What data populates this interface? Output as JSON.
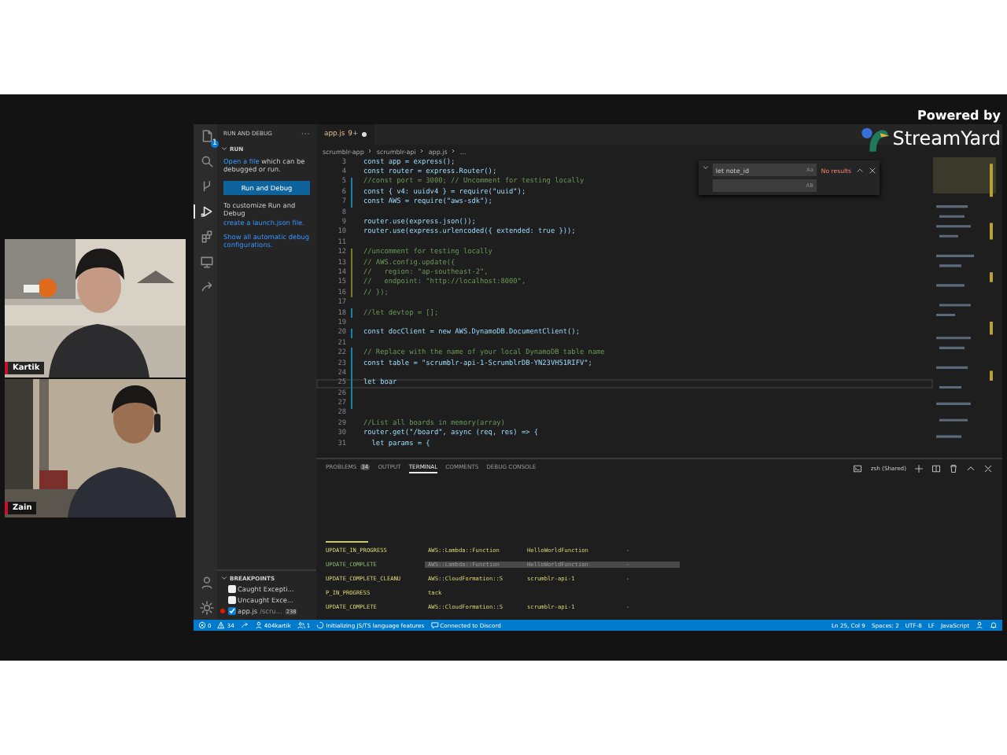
{
  "branding": {
    "powered_by": "Powered by",
    "logo_text": "StreamYard"
  },
  "participants": [
    {
      "name": "Kartik"
    },
    {
      "name": "Zain"
    }
  ],
  "editor_window": {
    "activity_bar": [
      {
        "kind": "files",
        "selected": false,
        "badge": "1"
      },
      {
        "kind": "search",
        "selected": false
      },
      {
        "kind": "branch",
        "selected": false
      },
      {
        "kind": "debug",
        "selected": true
      },
      {
        "kind": "extensions",
        "selected": false
      },
      {
        "kind": "remote",
        "selected": false
      },
      {
        "kind": "share",
        "selected": false
      }
    ],
    "activity_bar_bottom": [
      {
        "kind": "account"
      },
      {
        "kind": "gear"
      }
    ],
    "sidebar": {
      "title": "RUN AND DEBUG",
      "section": "RUN",
      "intro_link": "Open a file",
      "intro_rest": "which can be debugged or run.",
      "button": "Run and Debug",
      "customize_text": "To customize Run and Debug",
      "customize_link": "create a launch.json file.",
      "show_all": "Show all automatic debug configurations.",
      "breakpoints_title": "BREAKPOINTS",
      "breakpoints": [
        {
          "label": "Caught Excepti...",
          "checked": false
        },
        {
          "label": "Uncaught Exce...",
          "checked": false
        },
        {
          "label": "app.js",
          "path": "/scru...",
          "count": "238",
          "checked": true
        }
      ]
    },
    "tab": {
      "label": "app.js",
      "badge": "9+"
    },
    "breadcrumb": [
      "scrumblr-app",
      "scrumblr-api",
      "app.js",
      "..."
    ],
    "find": {
      "query": "let note_id",
      "case_label": "Aa",
      "result": "No results",
      "replace_label": "AB"
    },
    "code_lines": [
      {
        "number": "3",
        "text": "const app = express();",
        "kind": "code",
        "current": false
      },
      {
        "number": "4",
        "text": "const router = express.Router();",
        "kind": "code",
        "current": false
      },
      {
        "number": "5",
        "text": "//const port = 3000; // Uncomment for testing locally",
        "kind": "comment",
        "color": "#1b81a8",
        "current": false
      },
      {
        "number": "6",
        "text": "const { v4: uuidv4 } = require(\"uuid\");",
        "kind": "code",
        "color": "#1b81a8",
        "current": false
      },
      {
        "number": "7",
        "text": "const AWS = require(\"aws-sdk\");",
        "kind": "code",
        "color": "#1b81a8",
        "current": false
      },
      {
        "number": "8",
        "kind": "blank",
        "current": false
      },
      {
        "number": "9",
        "text": "router.use(express.json());",
        "kind": "code",
        "current": false
      },
      {
        "number": "10",
        "text": "router.use(express.urlencoded({ extended: true }));",
        "kind": "code",
        "current": false
      },
      {
        "number": "11",
        "kind": "blank",
        "current": false
      },
      {
        "number": "12",
        "text": "//uncomment for testing locally",
        "kind": "comment",
        "color": "#7a7a2e",
        "current": false
      },
      {
        "number": "13",
        "text": "// AWS.config.update({",
        "kind": "comment",
        "color": "#7a7a2e",
        "current": false
      },
      {
        "number": "14",
        "text": "//   region: \"ap-southeast-2\",",
        "kind": "comment",
        "color": "#7a7a2e",
        "current": false
      },
      {
        "number": "15",
        "text": "//   endpoint: \"http://localhost:8000\",",
        "kind": "comment",
        "color": "#7a7a2e",
        "current": false
      },
      {
        "number": "16",
        "text": "// });",
        "kind": "comment",
        "color": "#7a7a2e",
        "current": false
      },
      {
        "number": "17",
        "kind": "blank",
        "current": false
      },
      {
        "number": "18",
        "text": "//let devtop = [];",
        "kind": "comment",
        "color": "#1b81a8",
        "current": false
      },
      {
        "number": "19",
        "kind": "blank",
        "current": false
      },
      {
        "number": "20",
        "text": "const docClient = new AWS.DynamoDB.DocumentClient();",
        "kind": "code",
        "color": "#1b81a8",
        "current": false
      },
      {
        "number": "21",
        "kind": "blank",
        "current": false
      },
      {
        "number": "22",
        "text": "// Replace with the name of your local DynamoDB table name",
        "kind": "comment",
        "color": "#1b81a8",
        "current": false
      },
      {
        "number": "23",
        "text": "const table = \"scrumblr-api-1-ScrumblrDB-YN23VH51RIFV\";",
        "kind": "code",
        "color": "#1b81a8",
        "current": false
      },
      {
        "number": "24",
        "kind": "blank",
        "color": "#1b81a8",
        "current": false
      },
      {
        "number": "25",
        "text": "let boar",
        "kind": "code",
        "color": "#1b81a8",
        "current": true
      },
      {
        "number": "26",
        "kind": "blank",
        "color": "#1b81a8",
        "current": false
      },
      {
        "number": "27",
        "kind": "blank",
        "color": "#1b81a8",
        "current": false
      },
      {
        "number": "28",
        "kind": "blank",
        "current": false
      },
      {
        "number": "29",
        "text": "//List all boards in memory(array)",
        "kind": "comment",
        "current": false
      },
      {
        "number": "30",
        "text": "router.get(\"/board\", async (req, res) => {",
        "kind": "code",
        "current": false
      },
      {
        "number": "31",
        "text": "  let params = {",
        "kind": "code",
        "current": false
      }
    ],
    "panel_tabs": [
      {
        "label": "PROBLEMS",
        "count": "34",
        "selected": false
      },
      {
        "label": "OUTPUT",
        "selected": false
      },
      {
        "label": "TERMINAL",
        "selected": true
      },
      {
        "label": "COMMENTS",
        "selected": false
      },
      {
        "label": "DEBUG CONSOLE",
        "selected": false
      }
    ],
    "terminal_name": "zsh (Shared)",
    "terminal_rows": [
      {
        "status": "UPDATE_IN_PROGRESS",
        "type": "AWS::Lambda::Function",
        "resource": "HelloWorldFunction",
        "reason": "-",
        "selected": false
      },
      {
        "status": "UPDATE_COMPLETE",
        "type": "AWS::Lambda::Function",
        "resource": "HelloWorldFunction",
        "reason": "-",
        "selected": true
      },
      {
        "status": "UPDATE_COMPLETE_CLEANU",
        "type": "AWS::CloudFormation::S",
        "resource": "scrumblr-api-1",
        "reason": "-",
        "selected": false
      },
      {
        "status": "P_IN_PROGRESS",
        "type": "tack",
        "selected": false
      },
      {
        "status": "UPDATE_COMPLETE",
        "type": "AWS::CloudFormation::S",
        "resource": "scrumblr-api-1",
        "reason": "-",
        "selected": false
      }
    ],
    "status_left": [
      {
        "kind": "error",
        "text": "0"
      },
      {
        "kind": "warning",
        "text": "34"
      },
      {
        "kind": "share"
      },
      {
        "kind": "person",
        "text": "404kartik"
      },
      {
        "kind": "users",
        "text": "1"
      },
      {
        "kind": "spinner",
        "text": "Initializing JS/TS language features"
      },
      {
        "kind": "chat",
        "text": "Connected to Discord"
      }
    ],
    "status_right": [
      {
        "kind": "text",
        "text": "Ln 25, Col 9"
      },
      {
        "kind": "text",
        "text": "Spaces: 2"
      },
      {
        "kind": "text",
        "text": "UTF-8"
      },
      {
        "kind": "text",
        "text": "LF"
      },
      {
        "kind": "text",
        "text": "JavaScript"
      },
      {
        "kind": "person"
      },
      {
        "kind": "bell"
      }
    ]
  }
}
